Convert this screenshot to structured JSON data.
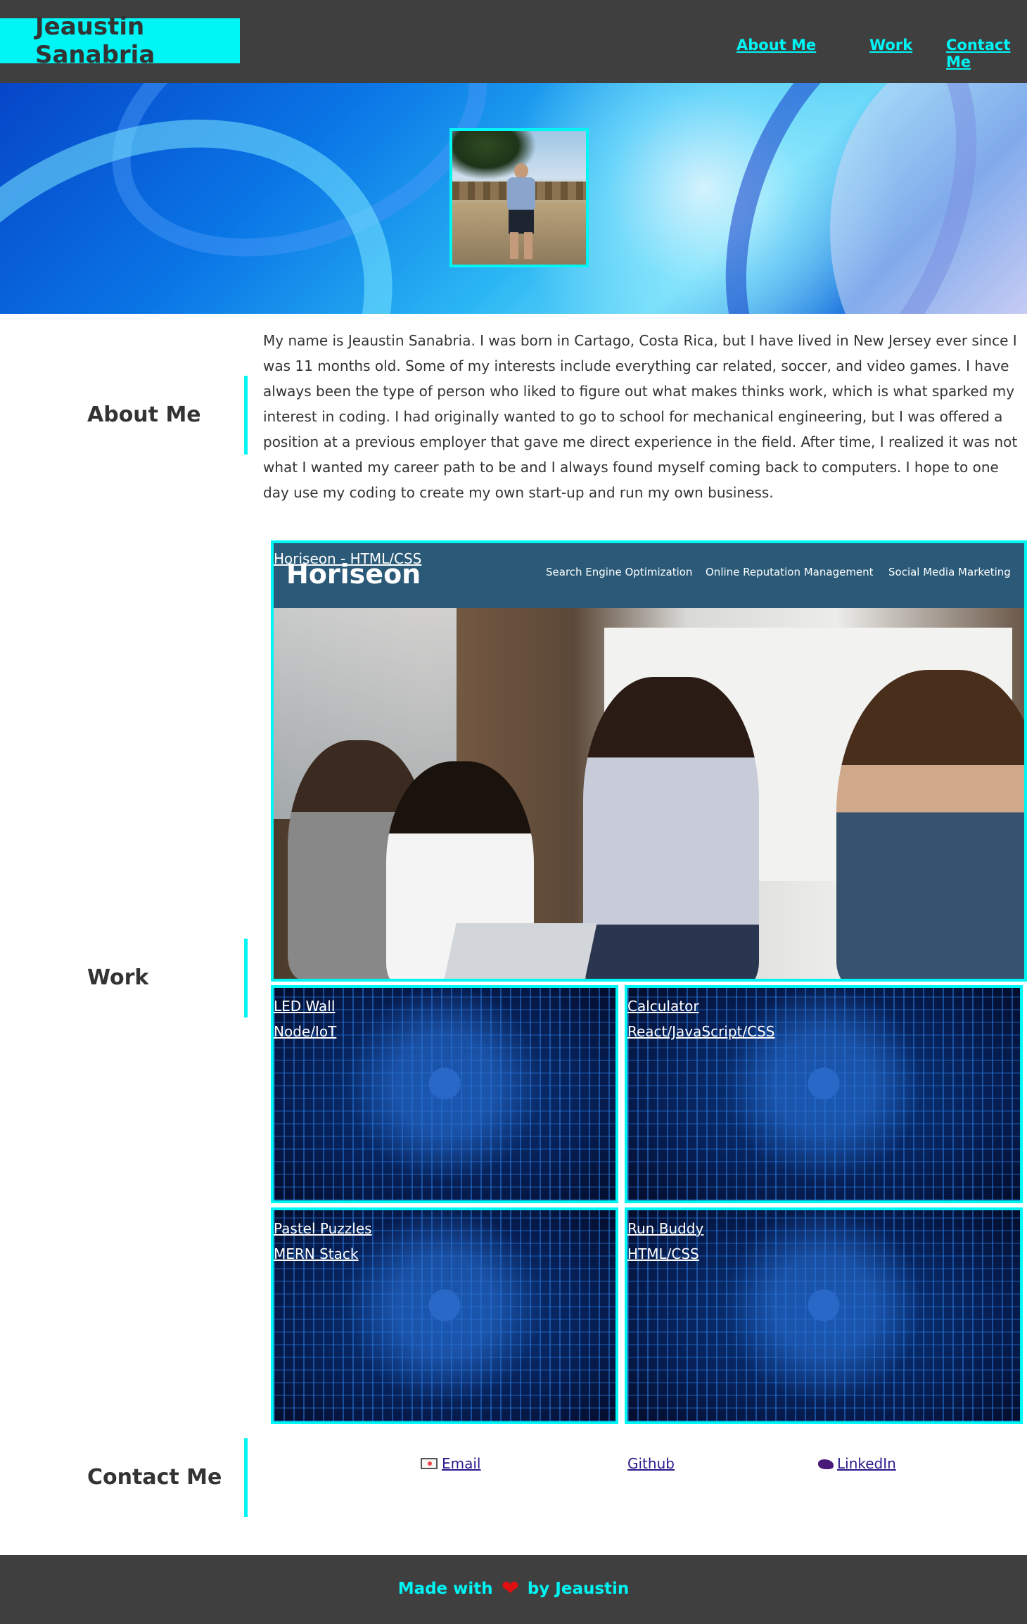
{
  "header": {
    "brand": "Jeaustin Sanabria",
    "nav": [
      "About Me",
      "Work",
      "Contact Me"
    ]
  },
  "about": {
    "heading": "About Me",
    "text": "My name is Jeaustin Sanabria. I was born in Cartago, Costa Rica, but I have lived in New Jersey ever since I was 11 months old. Some of my interests include everything car related, soccer, and video games. I have always been the type of person who liked to figure out what makes thinks work, which is what sparked my interest in coding. I had originally wanted to go to school for mechanical engineering, but I was offered a position at a previous employer that gave me direct experience in the field. After time, I realized it was not what I wanted my career path to be and I always found myself coming back to computers. I hope to one day use my coding to create my own start-up and run my own business."
  },
  "work": {
    "heading": "Work",
    "featured": {
      "label": "Horiseon - HTML/CSS",
      "screenshot_brand": "Horiseon",
      "screenshot_menu": [
        "Search Engine Optimization",
        "Online Reputation Management",
        "Social Media Marketing"
      ]
    },
    "projects": [
      {
        "title": "LED Wall",
        "tech": "Node/IoT"
      },
      {
        "title": "Calculator",
        "tech": "React/JavaScript/CSS"
      },
      {
        "title": "Pastel Puzzles",
        "tech": "MERN Stack"
      },
      {
        "title": "Run Buddy",
        "tech": "HTML/CSS"
      }
    ]
  },
  "contact": {
    "heading": "Contact Me",
    "links": [
      {
        "label": "Email",
        "icon": "mail-icon"
      },
      {
        "label": "Github",
        "icon": ""
      },
      {
        "label": "LinkedIn",
        "icon": "linkedin-icon"
      }
    ]
  },
  "footer": {
    "prefix": "Made with",
    "suffix": "by Jeaustin",
    "icon": "heart-icon"
  },
  "colors": {
    "accent": "#00f5f5",
    "header_bg": "#3f3f3f",
    "text": "#333333",
    "link": "#2a1a8c"
  }
}
